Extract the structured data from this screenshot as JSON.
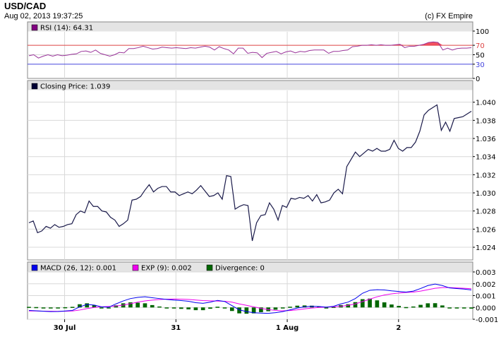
{
  "header": {
    "symbol": "USD/CAD",
    "datetime": "Aug 02, 2013 19:37:25",
    "credit": "(c) FX Empire"
  },
  "colors": {
    "price": "#1a1a4a",
    "rsi": "#993399",
    "rsi_upper": "#dd4444",
    "rsi_lower": "#4444dd",
    "rsi_fill": "#ee3344",
    "macd": "#0000ee",
    "exp": "#ee00ee",
    "divergence": "#006600",
    "grid": "#d8d8d8",
    "panel_header": "#e4e4e4"
  },
  "chart_data": [
    {
      "type": "line",
      "panel": "rsi",
      "legend": "RSI (14): 64.31",
      "legend_color": "#800080",
      "y_ticks": [
        "100",
        "70",
        "50",
        "30",
        "0"
      ],
      "y_tick_values": [
        100,
        70,
        50,
        30,
        0
      ],
      "ylim": [
        0,
        100
      ],
      "levels": {
        "upper": 70,
        "lower": 30
      },
      "values": [
        48,
        50,
        43,
        47,
        50,
        47,
        50,
        48,
        49,
        51,
        52,
        57,
        58,
        55,
        60,
        53,
        50,
        47,
        50,
        55,
        54,
        63,
        63,
        65,
        68,
        65,
        62,
        63,
        66,
        65,
        64,
        65,
        64,
        63,
        65,
        64,
        66,
        68,
        66,
        60,
        67,
        63,
        60,
        52,
        64,
        64,
        53,
        55,
        54,
        44,
        53,
        55,
        57,
        52,
        56,
        58,
        54,
        57,
        56,
        59,
        60,
        60,
        60,
        53,
        57,
        57,
        59,
        60,
        67,
        68,
        70,
        70,
        71,
        70,
        71,
        70,
        70,
        71,
        72,
        65,
        68,
        68,
        70,
        72,
        76,
        77,
        76,
        60,
        64,
        60,
        63,
        64,
        64,
        65
      ]
    },
    {
      "type": "line",
      "panel": "price",
      "legend": "Closing Price: 1.039",
      "legend_color": "#000033",
      "y_ticks": [
        "1.040",
        "1.038",
        "1.036",
        "1.034",
        "1.032",
        "1.030",
        "1.028",
        "1.026",
        "1.024"
      ],
      "y_tick_values": [
        1.04,
        1.038,
        1.036,
        1.034,
        1.032,
        1.03,
        1.028,
        1.026,
        1.024
      ],
      "ylim": [
        1.0226,
        1.0413
      ],
      "values": [
        1.0267,
        1.0269,
        1.0256,
        1.0258,
        1.0263,
        1.0261,
        1.0265,
        1.0262,
        1.0263,
        1.0265,
        1.0266,
        1.0276,
        1.028,
        1.0278,
        1.0291,
        1.0285,
        1.0285,
        1.028,
        1.0279,
        1.0273,
        1.027,
        1.0263,
        1.0266,
        1.027,
        1.0292,
        1.0293,
        1.0296,
        1.0303,
        1.0309,
        1.0301,
        1.0305,
        1.0307,
        1.0307,
        1.0301,
        1.0301,
        1.0297,
        1.0299,
        1.0301,
        1.0299,
        1.0303,
        1.0308,
        1.0302,
        1.0296,
        1.0297,
        1.03,
        1.0293,
        1.0319,
        1.0318,
        1.0282,
        1.0285,
        1.0287,
        1.0286,
        1.0247,
        1.0267,
        1.0275,
        1.0276,
        1.0289,
        1.0282,
        1.027,
        1.0286,
        1.0284,
        1.0294,
        1.0293,
        1.0295,
        1.0294,
        1.0297,
        1.0291,
        1.0298,
        1.0289,
        1.029,
        1.0292,
        1.03,
        1.0304,
        1.0299,
        1.0329,
        1.0337,
        1.0345,
        1.034,
        1.0344,
        1.0348,
        1.0346,
        1.0349,
        1.0346,
        1.0346,
        1.0348,
        1.0358,
        1.0349,
        1.0346,
        1.035,
        1.035,
        1.0356,
        1.0368,
        1.0386,
        1.0391,
        1.0394,
        1.0397,
        1.0369,
        1.0378,
        1.0368,
        1.0382,
        1.0383,
        1.0384,
        1.0387,
        1.039
      ]
    },
    {
      "type": "line",
      "panel": "macd",
      "legend_items": [
        {
          "label": "MACD (26, 12): 0.001",
          "color": "#0000ee"
        },
        {
          "label": "EXP (9): 0.002",
          "color": "#ee00ee"
        },
        {
          "label": "Divergence: 0",
          "color": "#006600"
        }
      ],
      "y_ticks": [
        "0.003",
        "0.002",
        "0.001",
        "0.000",
        "-0.001"
      ],
      "y_tick_values": [
        0.003,
        0.002,
        0.001,
        0.0,
        -0.001
      ],
      "ylim": [
        -0.001,
        0.003
      ],
      "series": [
        {
          "name": "MACD (26, 12)",
          "values": [
            -0.00025,
            -0.00028,
            -0.00032,
            -0.00035,
            -0.00034,
            -0.0003,
            -0.00025,
            5e-05,
            0.00025,
            0.0002,
            5e-05,
            2e-05,
            0.0003,
            0.00055,
            0.00075,
            0.00085,
            0.0009,
            0.00082,
            0.00075,
            0.00068,
            0.00062,
            0.00058,
            0.00052,
            0.0004,
            0.00035,
            0.00045,
            0.0006,
            0.0005,
            0.00015,
            -0.0002,
            -0.00035,
            -0.00045,
            -0.00048,
            -0.0005,
            -0.00044,
            -0.00035,
            -0.0002,
            -5e-05,
            5e-05,
            0.0001,
            8e-05,
            2e-05,
            0.0001,
            0.0003,
            0.00045,
            0.00075,
            0.0012,
            0.00145,
            0.0015,
            0.00148,
            0.0014,
            0.00135,
            0.0013,
            0.00138,
            0.0016,
            0.00185,
            0.00198,
            0.00185,
            0.00165,
            0.0016,
            0.00155,
            0.00148
          ]
        },
        {
          "name": "EXP (9)",
          "values": [
            -0.0003,
            -0.0003,
            -0.00031,
            -0.00032,
            -0.00033,
            -0.00032,
            -0.0003,
            -0.00022,
            -0.0001,
            0.0,
            5e-05,
            8e-05,
            0.00012,
            0.0002,
            0.00032,
            0.00045,
            0.00055,
            0.00062,
            0.00067,
            0.0007,
            0.00071,
            0.0007,
            0.00068,
            0.00063,
            0.00058,
            0.00056,
            0.00054,
            0.00052,
            0.00045,
            0.0003,
            0.00018,
            5e-05,
            -8e-05,
            -0.00018,
            -0.00025,
            -0.00028,
            -0.00026,
            -0.0002,
            -0.00012,
            -5e-05,
            0.0,
            3e-05,
            5e-05,
            0.0001,
            0.00018,
            0.0003,
            0.0005,
            0.0007,
            0.0009,
            0.00105,
            0.00115,
            0.00122,
            0.00127,
            0.0013,
            0.00138,
            0.0015,
            0.00162,
            0.00168,
            0.00168,
            0.00165,
            0.00162,
            0.00158
          ]
        },
        {
          "name": "Divergence",
          "values": [
            5e-05,
            3e-05,
            -2e-05,
            -3e-05,
            -2e-05,
            2e-05,
            5e-05,
            0.00027,
            0.00035,
            0.0002,
            0.0,
            -6e-05,
            0.00018,
            0.00035,
            0.00043,
            0.0004,
            0.00035,
            0.0002,
            8e-05,
            -2e-05,
            -9e-05,
            -0.00012,
            -0.00016,
            -0.00023,
            -0.00023,
            -0.00011,
            6e-05,
            -2e-05,
            -0.0003,
            -0.0005,
            -0.00053,
            -0.0005,
            -0.0004,
            -0.00032,
            -0.00019,
            -7e-05,
            6e-05,
            0.00015,
            0.00017,
            0.00015,
            8e-05,
            -1e-05,
            5e-05,
            0.0002,
            0.00027,
            0.00045,
            0.0007,
            0.00075,
            0.0006,
            0.00043,
            0.00025,
            0.00013,
            3e-05,
            8e-05,
            0.00022,
            0.00035,
            0.00036,
            0.00017,
            -3e-05,
            -5e-05,
            -7e-05,
            -0.0001
          ]
        }
      ]
    }
  ],
  "x_axis": {
    "labels": [
      "30 Jul",
      "31",
      "1 Aug",
      "2"
    ],
    "label_fractions": [
      0.0833,
      0.3333,
      0.5833,
      0.8333
    ]
  }
}
